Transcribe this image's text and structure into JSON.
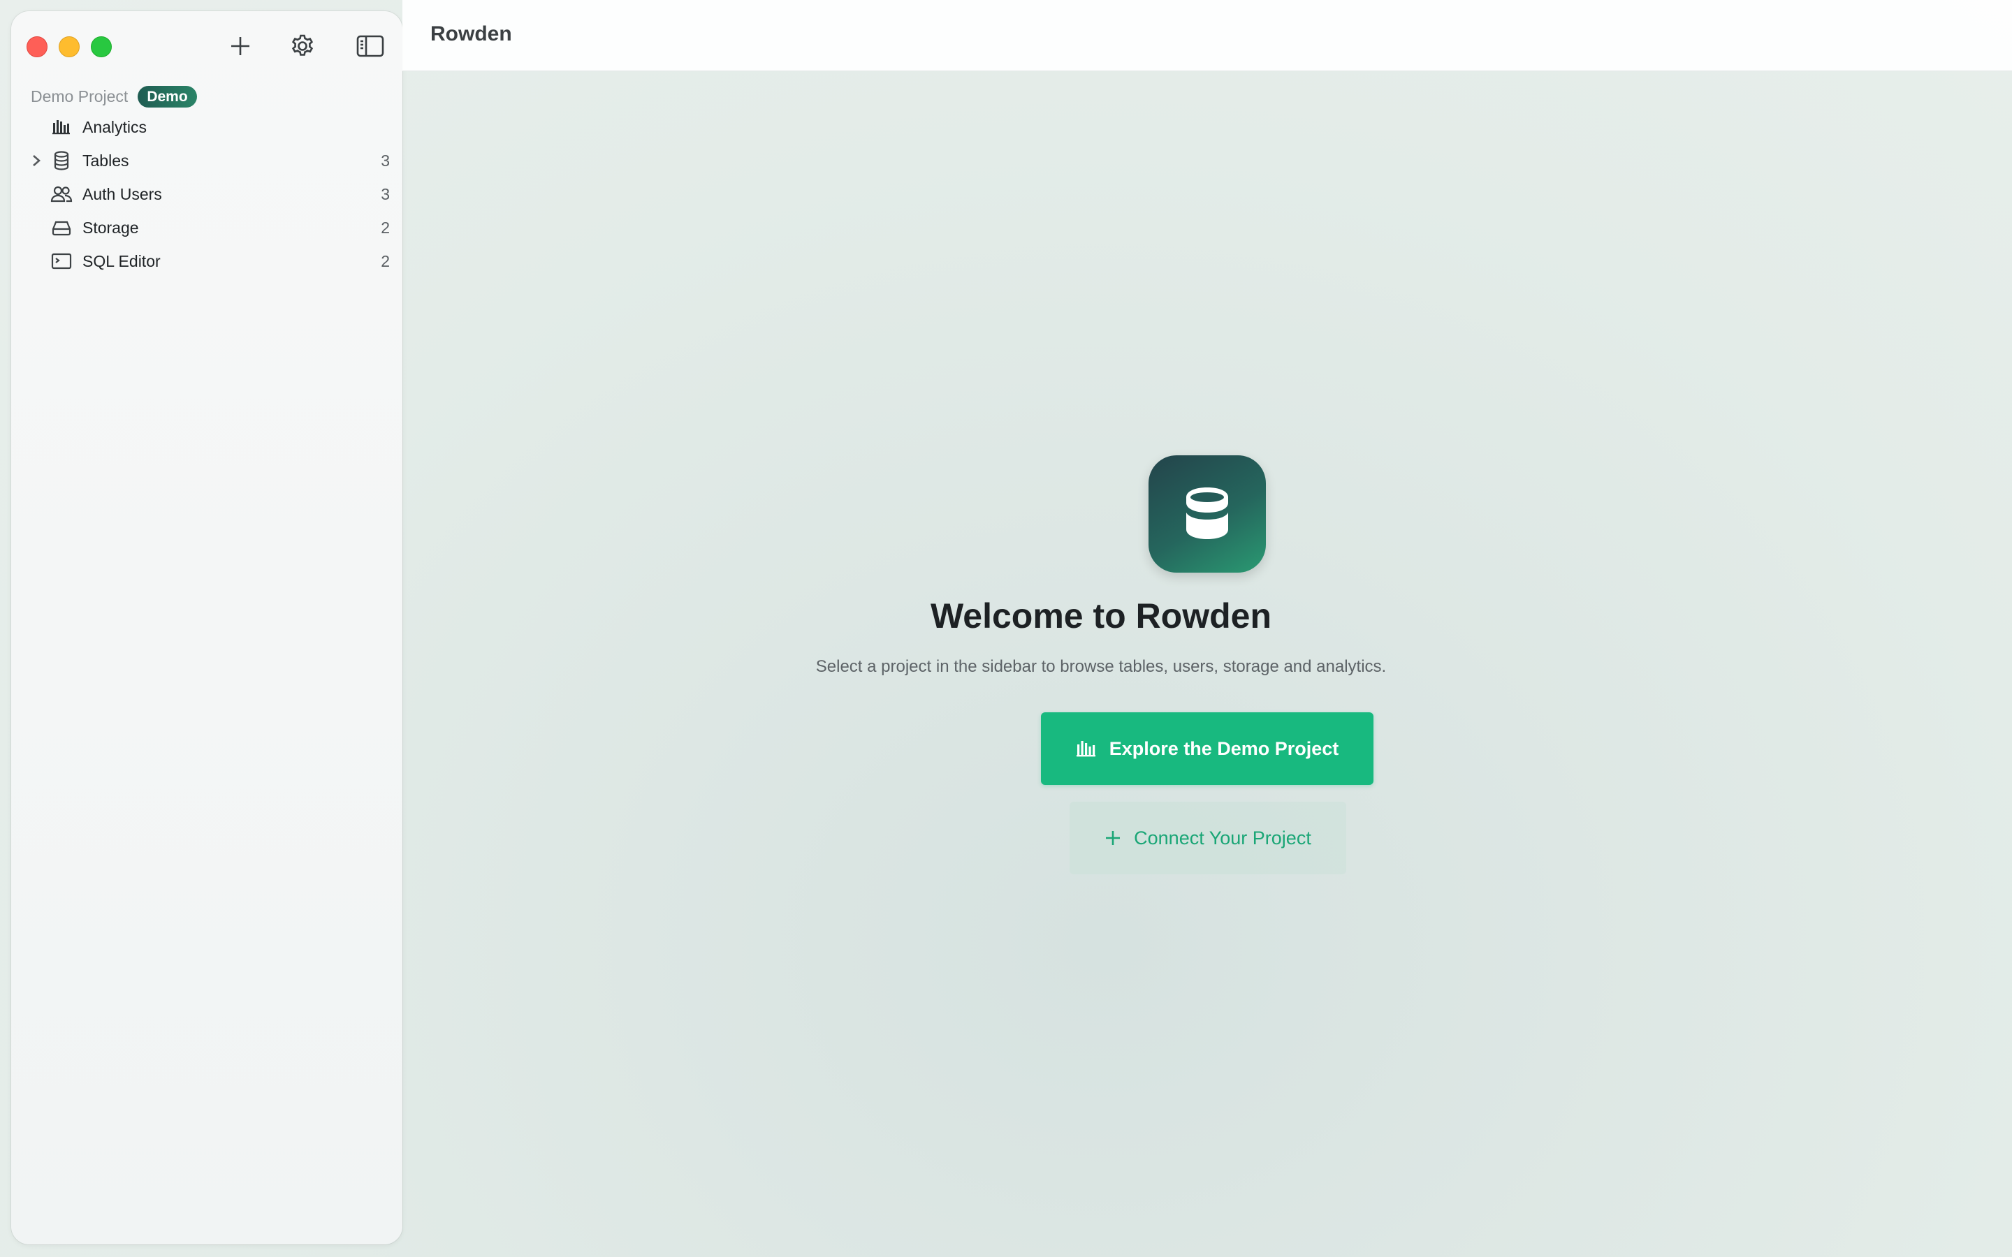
{
  "app": {
    "title": "Rowden"
  },
  "window_controls": [
    "close",
    "minimize",
    "maximize"
  ],
  "toolbar": {
    "icons": [
      "plus-icon",
      "gear-icon",
      "sidebar-toggle-icon"
    ]
  },
  "sidebar": {
    "project": {
      "name": "Demo Project",
      "badge": "Demo"
    },
    "items": [
      {
        "label": "Analytics",
        "icon": "bar-chart-icon",
        "count": "",
        "expandable": false
      },
      {
        "label": "Tables",
        "icon": "database-icon",
        "count": "3",
        "expandable": true
      },
      {
        "label": "Auth Users",
        "icon": "users-icon",
        "count": "3",
        "expandable": false
      },
      {
        "label": "Storage",
        "icon": "drive-icon",
        "count": "2",
        "expandable": false
      },
      {
        "label": "SQL Editor",
        "icon": "terminal-icon",
        "count": "2",
        "expandable": false
      }
    ]
  },
  "welcome": {
    "logo_icon": "database-icon",
    "title": "Welcome to Rowden",
    "subtitle": "Select a project in the sidebar to browse tables, users, storage and analytics.",
    "primary_button": {
      "label": "Explore the Demo Project",
      "icon": "bar-chart-icon"
    },
    "secondary_button": {
      "label": "Connect Your Project",
      "icon": "plus-icon"
    }
  },
  "colors": {
    "accent": "#18b97f",
    "badge": "#1f5c52",
    "logo_dark": "#23444b",
    "logo_light": "#2a9a72"
  }
}
